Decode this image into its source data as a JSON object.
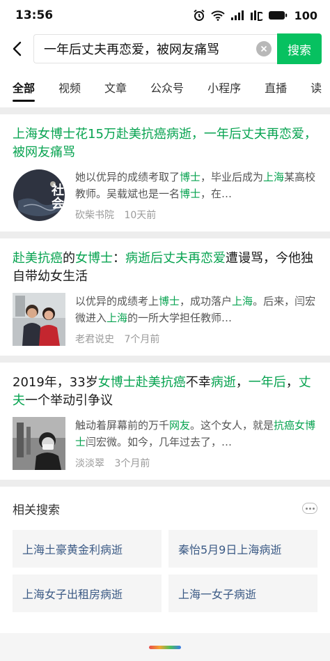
{
  "status": {
    "time": "13:56",
    "battery": "100"
  },
  "search": {
    "query": "一年后丈夫再恋爱，被网友痛骂",
    "button": "搜索"
  },
  "tabs": [
    "全部",
    "视频",
    "文章",
    "公众号",
    "小程序",
    "直播",
    "读"
  ],
  "results": [
    {
      "title": [
        {
          "t": "上海女博士花15万赴美抗癌病逝，一年后丈夫再恋爱，被网友痛骂",
          "h": true
        }
      ],
      "snippet": [
        {
          "t": "她以优异的成绩考取了",
          "h": false
        },
        {
          "t": "博士",
          "h": true
        },
        {
          "t": "，毕业后成为",
          "h": false
        },
        {
          "t": "上海",
          "h": true
        },
        {
          "t": "某高校教师。吴载斌也是一名",
          "h": false
        },
        {
          "t": "博士",
          "h": true
        },
        {
          "t": "，在…",
          "h": false
        }
      ],
      "thumb_text": "社会",
      "source": "砍柴书院",
      "time": "10天前"
    },
    {
      "title": [
        {
          "t": "赴美抗癌",
          "h": true
        },
        {
          "t": "的",
          "h": false
        },
        {
          "t": "女博士",
          "h": true
        },
        {
          "t": "：",
          "h": false
        },
        {
          "t": "病逝后丈夫再恋爱",
          "h": true
        },
        {
          "t": "遭谩骂，今他独自带幼女生活",
          "h": false
        }
      ],
      "snippet": [
        {
          "t": "以优异的成绩考上",
          "h": false
        },
        {
          "t": "博士",
          "h": true
        },
        {
          "t": "，成功落户",
          "h": false
        },
        {
          "t": "上海",
          "h": true
        },
        {
          "t": "。后来，闫宏微进入",
          "h": false
        },
        {
          "t": "上海",
          "h": true
        },
        {
          "t": "的一所大学担任教师…",
          "h": false
        }
      ],
      "source": "老君说史",
      "time": "7个月前"
    },
    {
      "title": [
        {
          "t": "2019年，33岁",
          "h": false
        },
        {
          "t": "女博士赴美抗癌",
          "h": true
        },
        {
          "t": "不幸",
          "h": false
        },
        {
          "t": "病逝",
          "h": true
        },
        {
          "t": "，",
          "h": false
        },
        {
          "t": "一年后",
          "h": true
        },
        {
          "t": "，",
          "h": false
        },
        {
          "t": "丈夫",
          "h": true
        },
        {
          "t": "一个举动引争议",
          "h": false
        }
      ],
      "snippet": [
        {
          "t": "触动着屏幕前的万千",
          "h": false
        },
        {
          "t": "网友",
          "h": true
        },
        {
          "t": "。这个女人，就是",
          "h": false
        },
        {
          "t": "抗癌女博士",
          "h": true
        },
        {
          "t": "闫宏微。如今，几年过去了，…",
          "h": false
        }
      ],
      "source": "淡淡翠",
      "time": "3个月前"
    }
  ],
  "related": {
    "title": "相关搜索",
    "items": [
      "上海土豪黄金利病逝",
      "秦怡5月9日上海病逝",
      "上海女子出租房病逝",
      "上海一女子病逝"
    ]
  },
  "colors": {
    "accent": "#07c160",
    "highlight": "#07a350",
    "link": "#3b5a85"
  }
}
